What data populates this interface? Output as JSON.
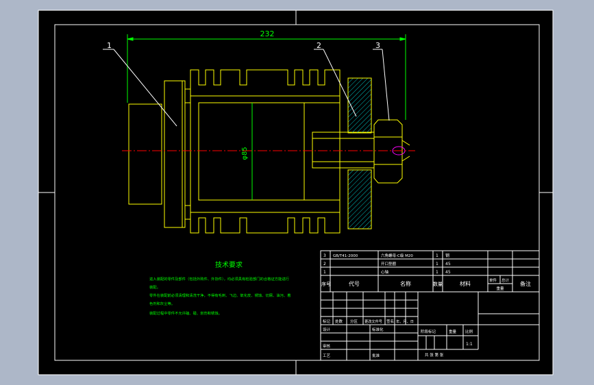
{
  "colors": {
    "background": "#adb7c8",
    "sheet": "#000000",
    "frame": "#ffffff",
    "part": "#ffff00",
    "centerline": "#ff0000",
    "dimension": "#00ff00",
    "notes": "#00ff00",
    "hatch": "#00c0c0",
    "thread": "#ff00ff"
  },
  "dimension": {
    "overall_length": "232",
    "diameter": "φ85"
  },
  "callouts": [
    "1",
    "2",
    "3"
  ],
  "notes": {
    "title": "技术要求",
    "lines": [
      "进入装配的零件及部件（包括外购件、外协件），均必须具有检验部门的合格证方能进行",
      "装配。",
      "零件在装配前必须清理和清洗干净，不得有毛刺、飞边、氧化皮、锈蚀、切屑、油污、着",
      "色剂和灰尘等。",
      "装配过程中零件不允许磕、碰、划伤和锈蚀。"
    ]
  },
  "bom": {
    "rows": [
      {
        "no": "3",
        "code": "GB/T41-2000",
        "name": "六角螺母-C级 M20",
        "qty": "1",
        "material": "钢"
      },
      {
        "no": "2",
        "code": "",
        "name": "开口垫圈",
        "qty": "1",
        "material": "45"
      },
      {
        "no": "1",
        "code": "",
        "name": "心轴",
        "qty": "1",
        "material": "45"
      }
    ],
    "header": {
      "no": "序号",
      "code": "代号",
      "name": "名称",
      "qty": "数量",
      "material": "材料",
      "unit_weight": "单件",
      "total_weight": "总计",
      "weight": "重量",
      "remark": "备注"
    }
  },
  "title_block": {
    "labels": {
      "mark": "标记",
      "count": "处数",
      "zone": "分区",
      "doc_no": "更改文件号",
      "sign": "签名",
      "date": "年、月、日",
      "design": "设计",
      "standardization": "标准化",
      "stage_mark": "阶段标记",
      "weight": "重量",
      "scale": "比例",
      "check": "审核",
      "process": "工艺",
      "approve": "批准",
      "sheets": "共 张 第 张"
    },
    "scale_value": "1:1"
  }
}
